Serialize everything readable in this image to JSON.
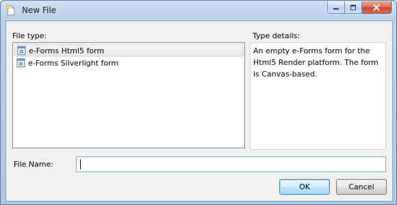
{
  "window": {
    "title": "New File",
    "icon": "new-file-icon",
    "controls": [
      "minimize-icon",
      "maximize-icon",
      "close-icon"
    ]
  },
  "file_type": {
    "label": "File type:",
    "items": [
      {
        "label": "e-Forms Html5 form",
        "icon": "form-icon",
        "selected": true
      },
      {
        "label": "e-Forms Silverlight form",
        "icon": "form-icon",
        "selected": false
      }
    ]
  },
  "type_details": {
    "label": "Type details:",
    "text": "An empty e-Forms form for the Html5 Render platform. The form is Canvas-based."
  },
  "file_name": {
    "label": "File Name:",
    "value": ""
  },
  "buttons": {
    "ok": "OK",
    "cancel": "Cancel"
  },
  "colors": {
    "title_bar": "#b9d0ea",
    "close_button": "#c2452e",
    "selection": "#e6e6e6",
    "focus_border": "#7aa7d6"
  }
}
